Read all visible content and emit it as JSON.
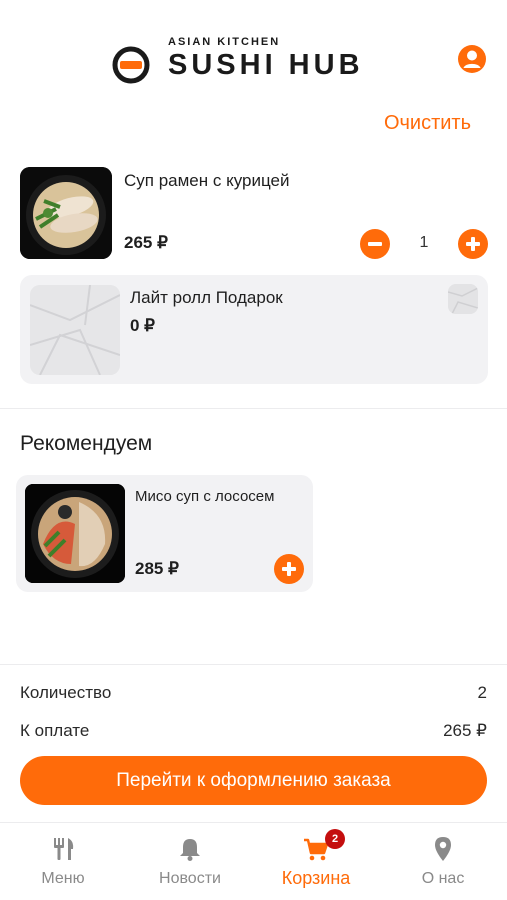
{
  "header": {
    "logo_subtitle": "ASIAN KITCHEN",
    "logo_title": "SUSHI HUB",
    "profile_icon": "user-icon"
  },
  "cart": {
    "clear_label": "Очистить",
    "items": [
      {
        "name": "Суп рамен с курицей",
        "price": "265 ₽",
        "quantity": "1"
      }
    ],
    "gift": {
      "name": "Лайт ролл Подарок",
      "price": "0 ₽"
    }
  },
  "recommend": {
    "title": "Рекомендуем",
    "items": [
      {
        "name": "Мисо суп с лососем",
        "price": "285 ₽"
      }
    ]
  },
  "summary": {
    "quantity_label": "Количество",
    "quantity_value": "2",
    "pay_label": "К оплате",
    "pay_value": "265 ₽"
  },
  "checkout_label": "Перейти к оформлению заказа",
  "tabs": [
    {
      "label": "Меню",
      "icon": "fork-knife-icon"
    },
    {
      "label": "Новости",
      "icon": "bell-icon"
    },
    {
      "label": "Корзина",
      "icon": "cart-icon",
      "badge": "2",
      "active": true
    },
    {
      "label": "О нас",
      "icon": "map-pin-icon"
    }
  ],
  "colors": {
    "accent": "#ff6b0a",
    "badge": "#c40e0e",
    "card_bg": "#f2f2f4",
    "inactive": "#8a8a8a"
  }
}
